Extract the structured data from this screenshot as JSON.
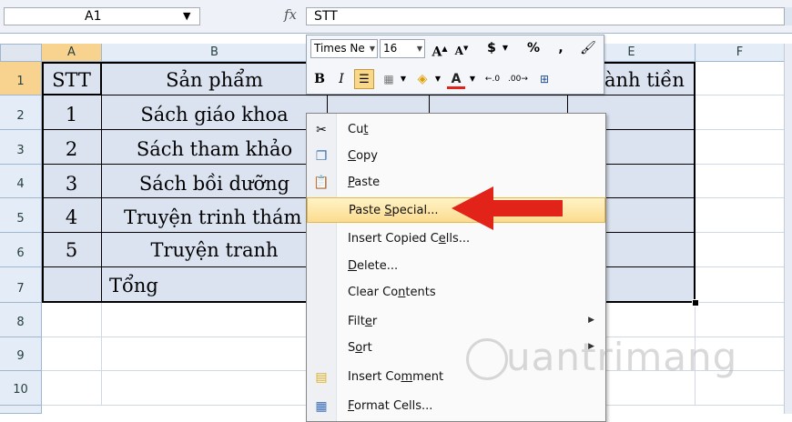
{
  "formula_bar": {
    "name_box": "A1",
    "fx": "fx",
    "formula": "STT"
  },
  "columns": [
    "A",
    "B",
    "C",
    "D",
    "E",
    "F"
  ],
  "rows": [
    "1",
    "2",
    "3",
    "4",
    "5",
    "6",
    "7",
    "8",
    "9",
    "10"
  ],
  "table": {
    "header": {
      "stt": "STT",
      "product": "Sản phẩm",
      "amount": "ành tiền"
    },
    "items": [
      {
        "stt": "1",
        "product": "Sách giáo khoa"
      },
      {
        "stt": "2",
        "product": "Sách tham khảo"
      },
      {
        "stt": "3",
        "product": "Sách bồi dưỡng"
      },
      {
        "stt": "4",
        "product": "Truyện trinh thám"
      },
      {
        "stt": "5",
        "product": "Truyện tranh"
      }
    ],
    "total_label": "Tổng"
  },
  "mini_toolbar": {
    "font": "Times Ne",
    "size": "16",
    "grow": "A",
    "shrink": "A",
    "currency": "$",
    "percent": "%",
    "comma": ",",
    "bold": "B",
    "italic": "I",
    "font_color": "A"
  },
  "context_menu": {
    "items": [
      {
        "pre": "Cu",
        "key": "t",
        "post": ""
      },
      {
        "pre": "",
        "key": "C",
        "post": "opy"
      },
      {
        "pre": "",
        "key": "P",
        "post": "aste"
      },
      {
        "pre": "Paste ",
        "key": "S",
        "post": "pecial..."
      },
      {
        "pre": "Insert Copied C",
        "key": "e",
        "post": "lls..."
      },
      {
        "pre": "",
        "key": "D",
        "post": "elete..."
      },
      {
        "pre": "Clear Co",
        "key": "n",
        "post": "tents"
      },
      {
        "pre": "Filt",
        "key": "e",
        "post": "r"
      },
      {
        "pre": "S",
        "key": "o",
        "post": "rt"
      },
      {
        "pre": "Insert Co",
        "key": "m",
        "post": "ment"
      },
      {
        "pre": "",
        "key": "F",
        "post": "ormat Cells..."
      }
    ]
  },
  "watermark": "uantrimang",
  "colors": {
    "highlight": "#fbdc8f",
    "arrow": "#e2231a",
    "table_fill": "#dbe3f1"
  }
}
